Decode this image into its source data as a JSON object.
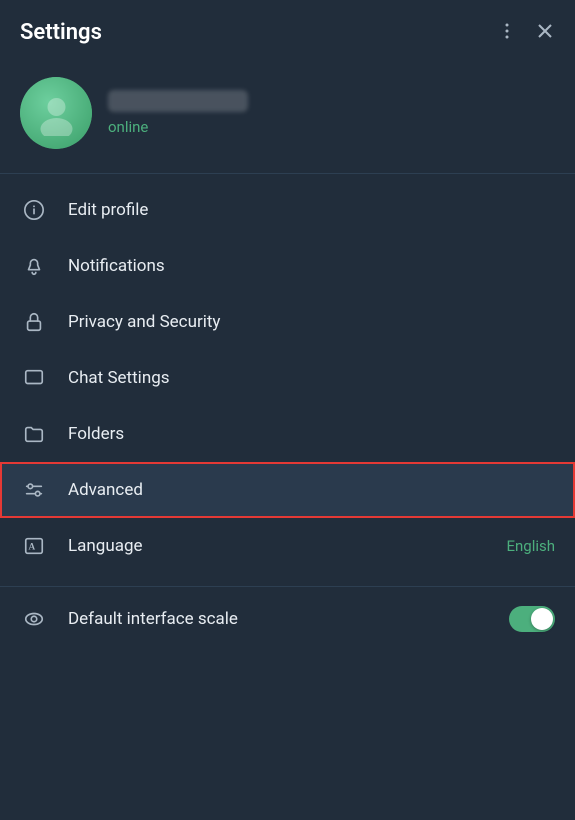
{
  "header": {
    "title": "Settings",
    "more_icon": "more-vertical-icon",
    "close_icon": "close-icon"
  },
  "profile": {
    "status": "online",
    "avatar_alt": "user avatar"
  },
  "menu": {
    "items": [
      {
        "id": "edit-profile",
        "label": "Edit profile",
        "icon": "info-icon",
        "value": null,
        "toggle": null
      },
      {
        "id": "notifications",
        "label": "Notifications",
        "icon": "bell-icon",
        "value": null,
        "toggle": null
      },
      {
        "id": "privacy-security",
        "label": "Privacy and Security",
        "icon": "lock-icon",
        "value": null,
        "toggle": null
      },
      {
        "id": "chat-settings",
        "label": "Chat Settings",
        "icon": "chat-icon",
        "value": null,
        "toggle": null
      },
      {
        "id": "folders",
        "label": "Folders",
        "icon": "folder-icon",
        "value": null,
        "toggle": null
      },
      {
        "id": "advanced",
        "label": "Advanced",
        "icon": "sliders-icon",
        "value": null,
        "toggle": null,
        "active": true
      },
      {
        "id": "language",
        "label": "Language",
        "icon": "language-icon",
        "value": "English",
        "toggle": null
      }
    ]
  },
  "bottom_section": {
    "label": "Default interface scale",
    "icon": "eye-icon",
    "toggle_on": true
  }
}
